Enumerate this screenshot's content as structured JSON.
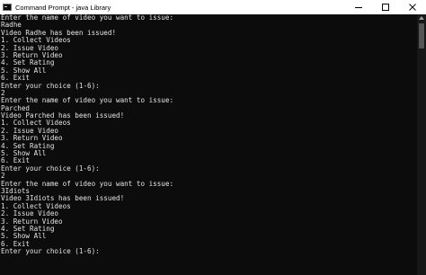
{
  "window": {
    "title": "Command Prompt - java  Library",
    "icon": "cmd-icon",
    "controls": [
      "minimize-icon",
      "maximize-icon",
      "close-icon"
    ]
  },
  "console": {
    "lines": [
      "Enter the name of video you want to issue:",
      "Radhe",
      "Video Radhe has been issued!",
      "1. Collect Videos",
      "2. Issue Video",
      "3. Return Video",
      "4. Set Rating",
      "5. Show All",
      "6. Exit",
      "Enter your choice (1-6):",
      "2",
      "Enter the name of video you want to issue:",
      "Parched",
      "Video Parched has been issued!",
      "1. Collect Videos",
      "2. Issue Video",
      "3. Return Video",
      "4. Set Rating",
      "5. Show All",
      "6. Exit",
      "Enter your choice (1-6):",
      "2",
      "Enter the name of video you want to issue:",
      "3Idiots",
      "Video 3Idiots has been issued!",
      "1. Collect Videos",
      "2. Issue Video",
      "3. Return Video",
      "4. Set Rating",
      "5. Show All",
      "6. Exit",
      "Enter your choice (1-6):"
    ]
  },
  "colors": {
    "console_bg": "#0c0c0c",
    "console_text": "#e4e4e4",
    "titlebar_bg": "#ffffff"
  }
}
